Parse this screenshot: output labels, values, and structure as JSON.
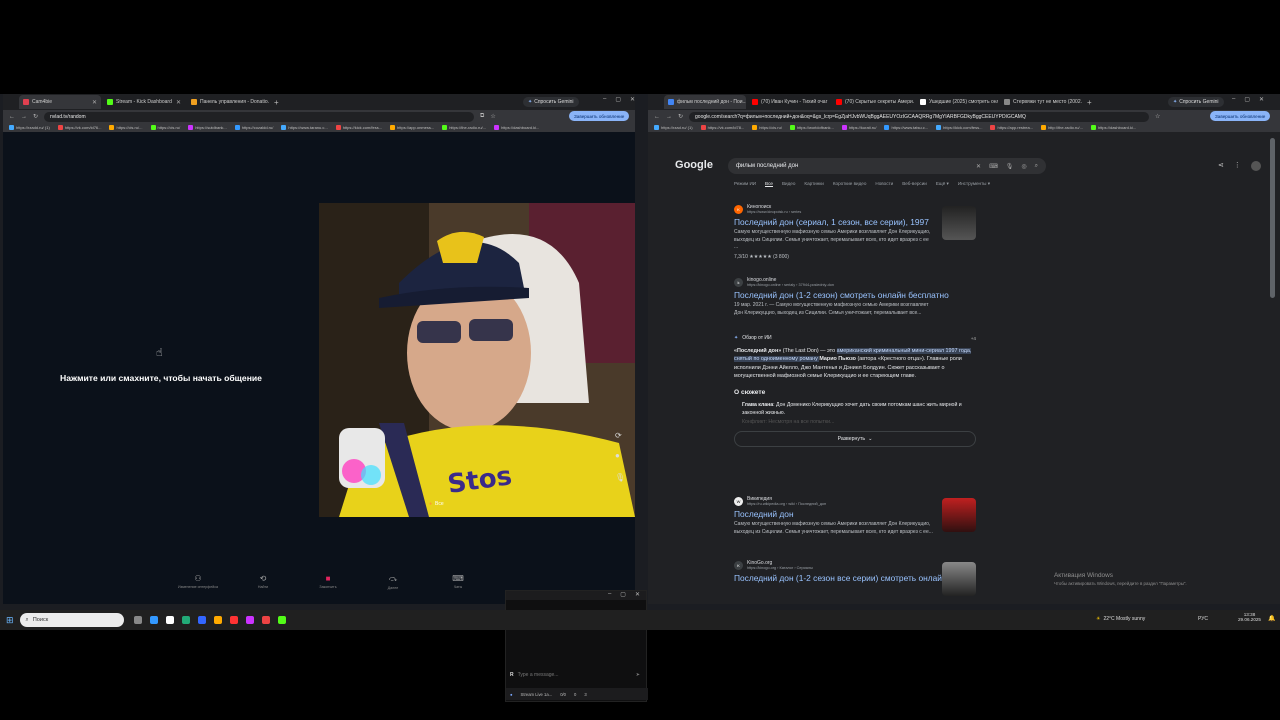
{
  "left_browser": {
    "tabs": [
      {
        "label": "Cam4bie",
        "color": "#e04050",
        "active": true
      },
      {
        "label": "Stream - Kick Dashboard",
        "color": "#53fc18",
        "active": false
      },
      {
        "label": "Панель управления - Donatio...",
        "color": "#f0a020",
        "active": false
      }
    ],
    "gemini": "Спросить Gemini",
    "url": "nvlad.tv/random",
    "update_btn": "Завершить обновление",
    "bookmarks": [
      "https://rzadd.ru/ (1)",
      "https://vk.com/id76...",
      "https://cis.ru/...",
      "https://cis.ru/",
      "https://sutdbank...",
      "https://cozaldd.ru/",
      "https://www.taranu.c...",
      "https://kick.com/fess...",
      "https://app.onmess...",
      "https://the-radio.ru/...",
      "https://dashboard.ki..."
    ],
    "prompt": "Нажмите или смахните, чтобы начать общение",
    "video_footer_label": "Все",
    "nav_items": [
      "Изменение интерфейса",
      "Найти",
      "Закончить",
      "Далее",
      "Чаты"
    ]
  },
  "chat": {
    "messages": [],
    "input_placeholder": "Type a message...",
    "avatar_letter": "R",
    "footer": [
      "Stream Live 1a...",
      "0/0",
      "0",
      "3"
    ]
  },
  "right_browser": {
    "tabs": [
      {
        "label": "фильм последний дон - Пои...",
        "color": "#4285f4",
        "active": true
      },
      {
        "label": "(70) Иван Кучин - Тихий очаг",
        "color": "#ff0000",
        "active": false
      },
      {
        "label": "(70) Скрытые секреты Амери...",
        "color": "#ff0000",
        "active": false
      },
      {
        "label": "Ушедшие (2025) смотреть онлайн",
        "color": "#ffffff",
        "active": false
      },
      {
        "label": "Стервяжи тут не место (2002...",
        "color": "#888888",
        "active": false
      }
    ],
    "gemini": "Спросить Gemini",
    "url": "google.com/search?q=фильм+последний+дон&oq=&gs_lcrp=EgZjaHJvbWUqBggAEEUYOzIGCAAQRRg7MgYIARBFGDkyBggCEEUYPDIGCAMQ",
    "update_btn": "Завершить обновление",
    "bookmarks": [
      "https://rzad.ru/ (1)",
      "https://vk.com/id78...",
      "https://cis.ru/",
      "https://worldofbank...",
      "https://kurati.ru/",
      "https://www.tatsu.c...",
      "https://kick.com/fess...",
      "https://app.restrea...",
      "http://the-radio.ru/...",
      "https://dashboard.ki..."
    ],
    "logo": [
      "G",
      "o",
      "o",
      "g",
      "l",
      "e"
    ],
    "logo_colors": [
      "#8ab4f8",
      "#f28b82",
      "#fdd663",
      "#8ab4f8",
      "#81c995",
      "#f28b82"
    ],
    "query": "фильм последний дон",
    "search_tabs": [
      "Режим ИИ",
      "Все",
      "Видео",
      "Картинки",
      "Короткие видео",
      "Новости",
      "Веб-версии",
      "Ещё ▾",
      "Инструменты ▾"
    ],
    "results": [
      {
        "site": "Кинопоиск",
        "url": "https://www.kinopoisk.ru › series",
        "title": "Последний дон (сериал, 1 сезон, все серии), 1997",
        "snippet": "Самую могущественную мафиозную семью Америки возглавляет Дон Клерикуццио, выходец из Сицилии. Семья уничтожает, перемалывает всех, кто идет вразрез с ее ...",
        "rating": "7,3/10 ★★★★★ (3 800)"
      },
      {
        "site": "kinogo.online",
        "url": "https://kinogo.online › serialy › 37944-posledniy-don",
        "title": "Последний дон (1-2 сезон) смотреть онлайн бесплатно",
        "snippet": "19 мар. 2021 г. — Самую могущественную мафиозную семью Америки возглавляет Дон Клерикуццио, выходец из Сицилии. Семья уничтожает, перемалывает все..."
      }
    ],
    "ai": {
      "header": "Обзор от ИИ",
      "plus": "+4",
      "text_lead": "«Последний дон»",
      "text_en": " (The Last Don) — это ",
      "text_hl": "американский криминальный мини-сериал 1997 года, снятый по одноименному роману ",
      "text_author": "Марио Пьюзо",
      "text_rest": " (автора «Крестного отца»). Главные роли исполнили Дэнни Айелло, Джо Мантенья и Дэниел Болдуин. Сюжет рассказывает о могущественной мафиозной семье Клерикуццио и ее стареющем главе.",
      "section": "О сюжете",
      "bullet1_lead": "Глава клана",
      "bullet1": ": Дон Доменико Клерикуццио хочет дать своим потомкам шанс жить мирной и законной жизнью.",
      "bullet2": "Конфликт: Несмотря на все попытки...",
      "expand": "Развернуть"
    },
    "results2": [
      {
        "site": "Википедия",
        "url": "https://ru.wikipedia.org › wiki › Последний_дон",
        "title": "Последний дон",
        "snippet": "Самую могущественную мафиозную семью Америки возглавляет Дон Клерикуццио, выходец из Сицилии. Семья уничтожает, перемалывает всех, кто идет вразрез с ее..."
      },
      {
        "site": "KinoGo.org",
        "url": "https://kinogo.org › Каталог › Сериалы",
        "title": "Последний дон (1-2 сезон все серии) смотреть онлайн",
        "snippet": ""
      }
    ],
    "activation": [
      "Активация Windows",
      "Чтобы активировать Windows, перейдите в раздел \"Параметры\"."
    ]
  },
  "taskbar": {
    "search": "Поиск",
    "weather": "22°C Mostly sunny",
    "lang": "РУС",
    "time": "13:38",
    "date": "29.06.2025"
  }
}
